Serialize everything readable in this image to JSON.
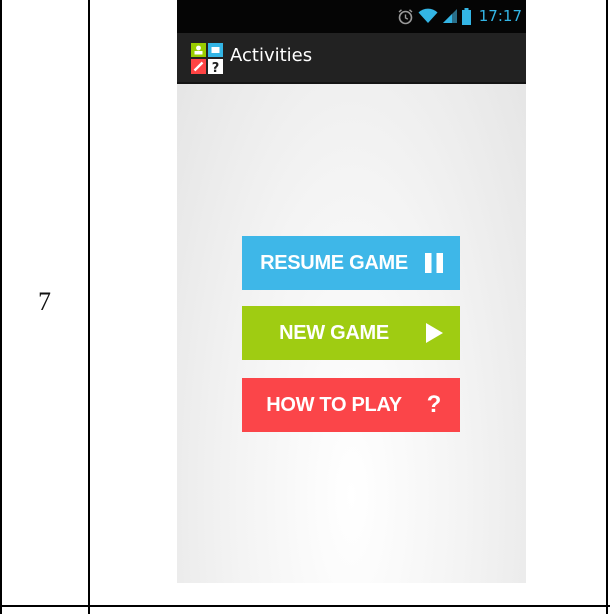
{
  "table": {
    "row_number": "7"
  },
  "status_bar": {
    "time": "17:17",
    "icons": [
      "alarm-icon",
      "wifi-icon",
      "signal-icon",
      "battery-icon"
    ]
  },
  "action_bar": {
    "title": "Activities",
    "logo_icon": "activities-app-logo-icon"
  },
  "menu": {
    "resume": {
      "label": "RESUME GAME",
      "icon": "pause-icon",
      "color": "#3eb7e8"
    },
    "new_game": {
      "label": "NEW GAME",
      "icon": "play-icon",
      "color": "#9fcc12"
    },
    "how_to_play": {
      "label": "HOW TO PLAY",
      "icon": "question-mark-icon",
      "icon_text": "?",
      "color": "#fb4549"
    }
  },
  "colors": {
    "accent_status": "#33b5e5",
    "action_bar": "#222222"
  }
}
